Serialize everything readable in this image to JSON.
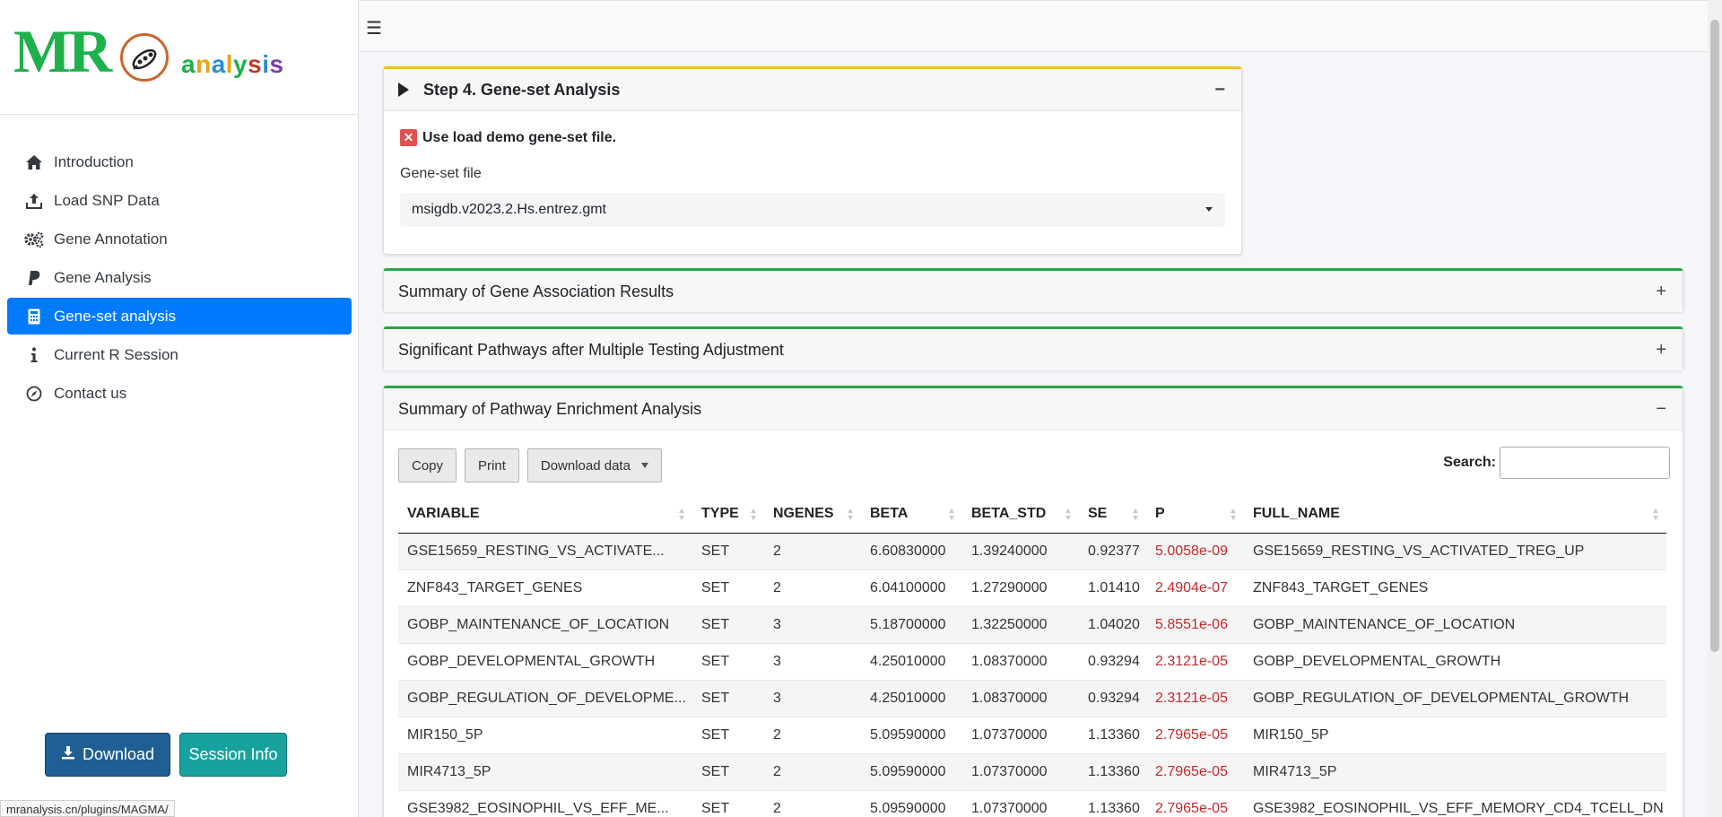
{
  "brand": {
    "mr": "MR",
    "analysis_letters": [
      "a",
      "n",
      "a",
      "l",
      "y",
      "s",
      "i",
      "s"
    ]
  },
  "sidebar": {
    "items": [
      {
        "label": "Introduction",
        "icon": "home-icon"
      },
      {
        "label": "Load SNP Data",
        "icon": "upload-icon"
      },
      {
        "label": "Gene Annotation",
        "icon": "cogs-icon"
      },
      {
        "label": "Gene Analysis",
        "icon": "paypal-icon"
      },
      {
        "label": "Gene-set analysis",
        "icon": "calculator-icon",
        "active": true
      },
      {
        "label": "Current R Session",
        "icon": "info-icon"
      },
      {
        "label": "Contact us",
        "icon": "compass-icon"
      }
    ],
    "download_label": "Download",
    "session_info_label": "Session Info"
  },
  "status_url": "mranalysis.cn/plugins/MAGMA/",
  "step_card": {
    "title": "Step 4. Gene-set Analysis",
    "toggle": "−",
    "checkbox_label": "Use load demo gene-set file.",
    "field_label": "Gene-set file",
    "select_value": "msigdb.v2023.2.Hs.entrez.gmt"
  },
  "collapsed_cards": [
    {
      "title": "Summary of Gene Association Results",
      "toggle": "+"
    },
    {
      "title": "Significant Pathways after Multiple Testing Adjustment",
      "toggle": "+"
    }
  ],
  "table_card": {
    "title": "Summary of Pathway Enrichment Analysis",
    "toggle": "−",
    "buttons": {
      "copy": "Copy",
      "print": "Print",
      "download": "Download data"
    },
    "search_label": "Search:",
    "columns": [
      "VARIABLE",
      "TYPE",
      "NGENES",
      "BETA",
      "BETA_STD",
      "SE",
      "P",
      "FULL_NAME"
    ],
    "rows": [
      [
        "GSE15659_RESTING_VS_ACTIVATE...",
        "SET",
        "2",
        "6.60830000",
        "1.39240000",
        "0.92377",
        "5.0058e-09",
        "GSE15659_RESTING_VS_ACTIVATED_TREG_UP"
      ],
      [
        "ZNF843_TARGET_GENES",
        "SET",
        "2",
        "6.04100000",
        "1.27290000",
        "1.01410",
        "2.4904e-07",
        "ZNF843_TARGET_GENES"
      ],
      [
        "GOBP_MAINTENANCE_OF_LOCATION",
        "SET",
        "3",
        "5.18700000",
        "1.32250000",
        "1.04020",
        "5.8551e-06",
        "GOBP_MAINTENANCE_OF_LOCATION"
      ],
      [
        "GOBP_DEVELOPMENTAL_GROWTH",
        "SET",
        "3",
        "4.25010000",
        "1.08370000",
        "0.93294",
        "2.3121e-05",
        "GOBP_DEVELOPMENTAL_GROWTH"
      ],
      [
        "GOBP_REGULATION_OF_DEVELOPME...",
        "SET",
        "3",
        "4.25010000",
        "1.08370000",
        "0.93294",
        "2.3121e-05",
        "GOBP_REGULATION_OF_DEVELOPMENTAL_GROWTH"
      ],
      [
        "MIR150_5P",
        "SET",
        "2",
        "5.09590000",
        "1.07370000",
        "1.13360",
        "2.7965e-05",
        "MIR150_5P"
      ],
      [
        "MIR4713_5P",
        "SET",
        "2",
        "5.09590000",
        "1.07370000",
        "1.13360",
        "2.7965e-05",
        "MIR4713_5P"
      ],
      [
        "GSE3982_EOSINOPHIL_VS_EFF_ME...",
        "SET",
        "2",
        "5.09590000",
        "1.07370000",
        "1.13360",
        "2.7965e-05",
        "GSE3982_EOSINOPHIL_VS_EFF_MEMORY_CD4_TCELL_DN"
      ]
    ]
  },
  "colors": {
    "active_nav": "#007bff",
    "step_accent": "#f0c02c",
    "card_accent": "#28a745",
    "p_value": "#c62828",
    "download_button": "#1f5f93",
    "session_button": "#17a2a0"
  }
}
